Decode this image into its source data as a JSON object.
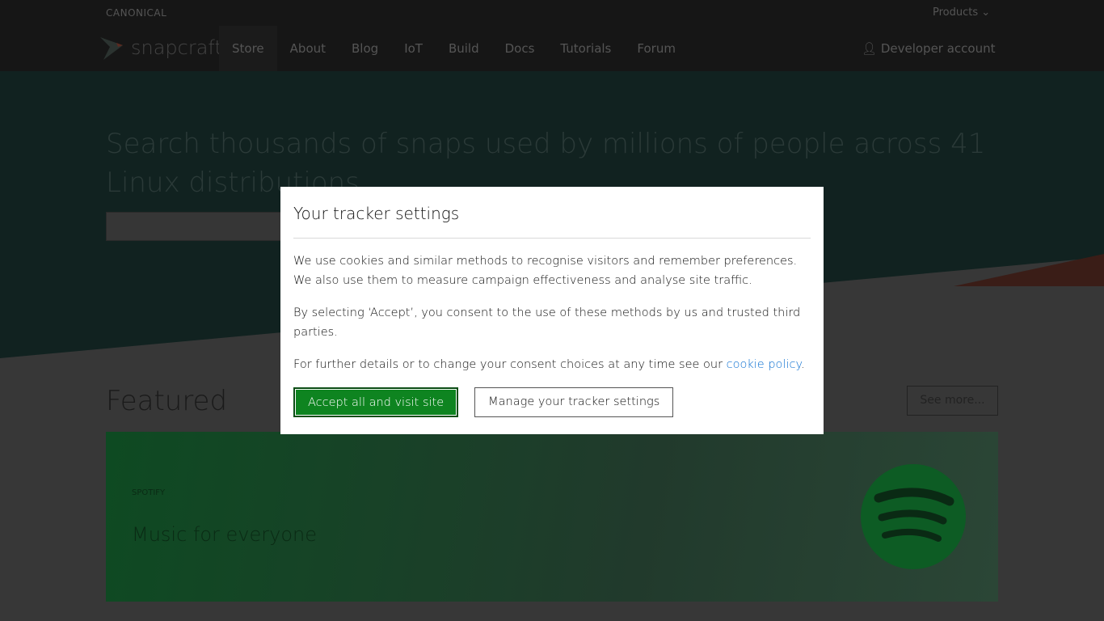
{
  "header": {
    "brand": "CANONICAL",
    "products": "Products",
    "logo": "snapcraft",
    "nav": [
      "Store",
      "About",
      "Blog",
      "IoT",
      "Build",
      "Docs",
      "Tutorials",
      "Forum"
    ],
    "developer": "Developer account"
  },
  "hero": {
    "title": "Search thousands of snaps used by millions of people across 41 Linux distributions"
  },
  "featured": {
    "title": "Featured",
    "see_more": "See more...",
    "card": {
      "tag": "SPOTIFY",
      "headline": "Music for everyone"
    }
  },
  "modal": {
    "title": "Your tracker settings",
    "p1": "We use cookies and similar methods to recognise visitors and remember preferences. We also use them to measure campaign effectiveness and analyse site traffic.",
    "p2": "By selecting ‘Accept’, you consent to the use of these methods by us and trusted third parties.",
    "p3_pre": "For further details or to change your consent choices at any time see our ",
    "p3_link": "cookie policy",
    "p3_post": ".",
    "accept": "Accept all and visit site",
    "manage": "Manage your tracker settings"
  }
}
